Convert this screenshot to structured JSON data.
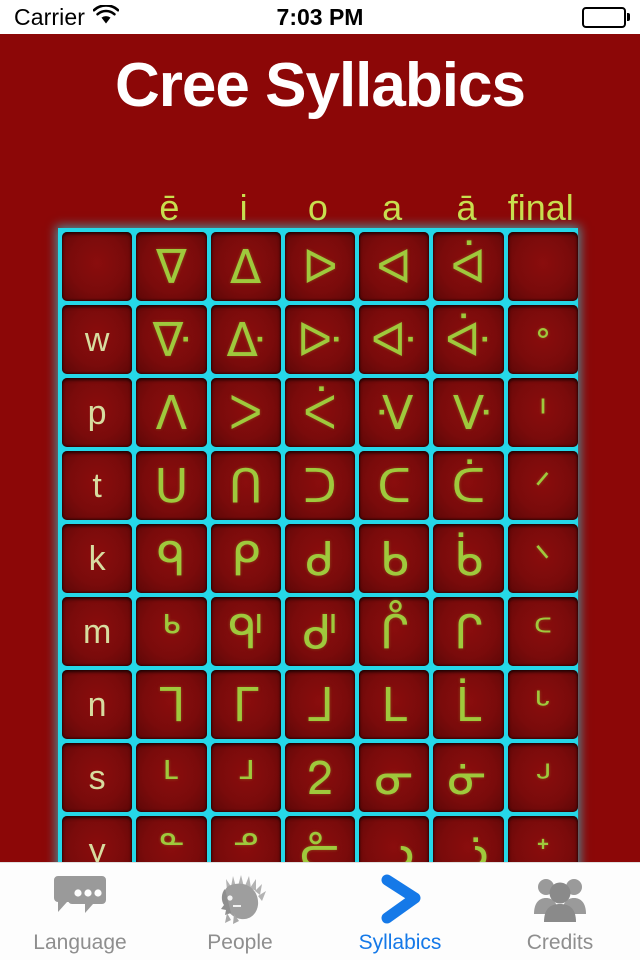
{
  "status_bar": {
    "carrier": "Carrier",
    "wifi_icon": "wifi-icon",
    "time": "7:03 PM",
    "battery_icon": "battery-full-icon"
  },
  "header": {
    "title": "Cree Syllabics"
  },
  "colors": {
    "background_red": "#8c0707",
    "cell_red": "#7a0b0b",
    "grid_cyan": "#25d7e8",
    "glyph_green": "#9fc93c",
    "header_green": "#c9de4e",
    "row_label": "#d7dca0",
    "title_white": "#ffffff",
    "tab_inactive": "#8e8e8e",
    "tab_active": "#1579e8",
    "tab_bg": "#fdfdfd"
  },
  "chart_data": {
    "type": "table",
    "title": "Cree Syllabics",
    "columns": [
      "",
      "ē",
      "i",
      "o",
      "a",
      "ā",
      "final"
    ],
    "row_labels": [
      "",
      "w",
      "p",
      "t",
      "k",
      "m",
      "n",
      "s",
      "y"
    ],
    "rows": [
      {
        "label": "",
        "cells": [
          "",
          "ᐁ",
          "ᐃ",
          "ᐅ",
          "ᐊ",
          "ᐋ",
          ""
        ]
      },
      {
        "label": "w",
        "cells": [
          "w",
          "ᐍ",
          "ᐏ",
          "ᐓ",
          "ᐘ",
          "ᐚ",
          "ᐤ"
        ]
      },
      {
        "label": "p",
        "cells": [
          "p",
          "ᐱ",
          "ᐳ",
          "ᐹ",
          "ᐺ",
          "ᐻ",
          "ᑊ"
        ]
      },
      {
        "label": "t",
        "cells": [
          "t",
          "ᑌ",
          "ᑎ",
          "ᑐ",
          "ᑕ",
          "ᑖ",
          "ᐟ"
        ]
      },
      {
        "label": "k",
        "cells": [
          "k",
          "ᑫ",
          "ᑭ",
          "ᑯ",
          "ᑲ",
          "ᑳ",
          "ᐠ"
        ]
      },
      {
        "label": "m",
        "cells": [
          "m",
          "ᒃ",
          "ᒅ",
          "ᒇ",
          "ᒊ",
          "ᒋ",
          "ᒼ"
        ]
      },
      {
        "label": "n",
        "cells": [
          "n",
          "ᒣ",
          "ᒥ",
          "ᒧ",
          "ᒪ",
          "ᒫ",
          "ᒡ"
        ]
      },
      {
        "label": "s",
        "cells": [
          "s",
          "ᒻ",
          "ᒽ",
          "ᒿ",
          "ᓂ",
          "ᓃ",
          "ᒢ"
        ]
      },
      {
        "label": "y",
        "cells": [
          "y",
          "ᓐ",
          "ᓒ",
          "ᓔ",
          "ᓗ",
          "ᓘ",
          "ᕀ"
        ]
      }
    ]
  },
  "tab_bar": {
    "items": [
      {
        "label": "Language",
        "icon": "chat-bubbles-icon",
        "active": false
      },
      {
        "label": "People",
        "icon": "chief-headdress-icon",
        "active": false
      },
      {
        "label": "Syllabics",
        "icon": "chevron-right-icon",
        "active": true
      },
      {
        "label": "Credits",
        "icon": "people-group-icon",
        "active": false
      }
    ]
  }
}
